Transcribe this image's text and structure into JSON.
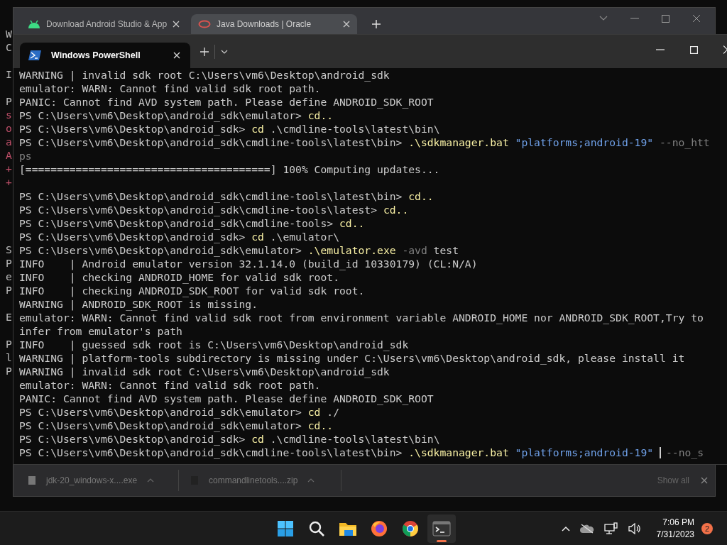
{
  "background_window": {
    "groups": [
      {
        "fragments": [
          {
            "text": "W",
            "color": "#bbbbbb"
          },
          {
            "text": "C",
            "color": "#bbbbbb"
          }
        ]
      },
      {
        "fragments": [
          {
            "text": "I",
            "color": "#bbbbbb"
          }
        ]
      },
      {
        "fragments": [
          {
            "text": "P",
            "color": "#bbbbbb"
          },
          {
            "text": "s",
            "color": "#c0506a"
          },
          {
            "text": "o",
            "color": "#c0506a"
          },
          {
            "text": "a",
            "color": "#c0506a"
          },
          {
            "text": "A",
            "color": "#c0506a"
          },
          {
            "text": "+",
            "color": "#c0506a"
          },
          {
            "text": "+",
            "color": "#c0506a"
          }
        ]
      },
      {
        "fragments": [
          {
            "text": "S",
            "color": "#bbbbbb"
          },
          {
            "text": "P",
            "color": "#bbbbbb"
          },
          {
            "text": "e",
            "color": "#bbbbbb"
          },
          {
            "text": "P",
            "color": "#bbbbbb"
          }
        ]
      },
      {
        "fragments": [
          {
            "text": "E",
            "color": "#bbbbbb"
          }
        ]
      },
      {
        "fragments": [
          {
            "text": "P",
            "color": "#bbbbbb"
          },
          {
            "text": "l",
            "color": "#bbbbbb"
          },
          {
            "text": "P",
            "color": "#bbbbbb"
          }
        ]
      }
    ]
  },
  "browser": {
    "tabs": [
      {
        "title": "Download Android Studio & App",
        "kind": "android",
        "selected": false
      },
      {
        "title": "Java Downloads | Oracle",
        "kind": "oracle",
        "selected": true
      }
    ],
    "downloads": [
      {
        "name": "jdk-20_windows-x....exe",
        "kind": "file"
      },
      {
        "name": "commandlinetools....zip",
        "kind": "zip"
      }
    ],
    "show_all": "Show all"
  },
  "terminal": {
    "tabs": [
      {
        "title": "Windows PowerShell",
        "selected": true
      }
    ],
    "lines": [
      {
        "kind": "text",
        "segments": [
          {
            "text": "WARNING | invalid sdk root C:\\Users\\vm6\\Desktop\\android_sdk",
            "kind": "output"
          }
        ]
      },
      {
        "kind": "text",
        "segments": [
          {
            "text": "emulator: WARN: Cannot find valid sdk root path.",
            "kind": "output"
          }
        ]
      },
      {
        "kind": "text",
        "segments": [
          {
            "text": "PANIC: Cannot find AVD system path. Please define ANDROID_SDK_ROOT",
            "kind": "output"
          }
        ]
      },
      {
        "kind": "text",
        "segments": [
          {
            "text": "PS C:\\Users\\vm6\\Desktop\\android_sdk\\emulator> ",
            "kind": "prompt"
          },
          {
            "text": "cd..",
            "kind": "command"
          }
        ]
      },
      {
        "kind": "text",
        "segments": [
          {
            "text": "PS C:\\Users\\vm6\\Desktop\\android_sdk> ",
            "kind": "prompt"
          },
          {
            "text": "cd",
            "kind": "command"
          },
          {
            "text": " .\\cmdline-tools\\latest\\bin\\",
            "kind": "argument"
          }
        ]
      },
      {
        "kind": "text",
        "segments": [
          {
            "text": "PS C:\\Users\\vm6\\Desktop\\android_sdk\\cmdline-tools\\latest\\bin> ",
            "kind": "prompt"
          },
          {
            "text": ".\\sdkmanager.bat",
            "kind": "command"
          },
          {
            "text": " \"platforms;android-19\"",
            "kind": "string"
          },
          {
            "text": " --no_htt",
            "kind": "parameter"
          }
        ]
      },
      {
        "kind": "text",
        "segments": [
          {
            "text": "ps",
            "kind": "parameter"
          }
        ]
      },
      {
        "kind": "text",
        "segments": [
          {
            "text": "[=======================================] 100% Computing updates...",
            "kind": "output"
          }
        ]
      },
      {
        "kind": "blank"
      },
      {
        "kind": "text",
        "segments": [
          {
            "text": "PS C:\\Users\\vm6\\Desktop\\android_sdk\\cmdline-tools\\latest\\bin> ",
            "kind": "prompt"
          },
          {
            "text": "cd..",
            "kind": "command"
          }
        ]
      },
      {
        "kind": "text",
        "segments": [
          {
            "text": "PS C:\\Users\\vm6\\Desktop\\android_sdk\\cmdline-tools\\latest> ",
            "kind": "prompt"
          },
          {
            "text": "cd..",
            "kind": "command"
          }
        ]
      },
      {
        "kind": "text",
        "segments": [
          {
            "text": "PS C:\\Users\\vm6\\Desktop\\android_sdk\\cmdline-tools> ",
            "kind": "prompt"
          },
          {
            "text": "cd..",
            "kind": "command"
          }
        ]
      },
      {
        "kind": "text",
        "segments": [
          {
            "text": "PS C:\\Users\\vm6\\Desktop\\android_sdk> ",
            "kind": "prompt"
          },
          {
            "text": "cd",
            "kind": "command"
          },
          {
            "text": " .\\emulator\\",
            "kind": "argument"
          }
        ]
      },
      {
        "kind": "text",
        "segments": [
          {
            "text": "PS C:\\Users\\vm6\\Desktop\\android_sdk\\emulator> ",
            "kind": "prompt"
          },
          {
            "text": ".\\emulator.exe",
            "kind": "command"
          },
          {
            "text": " -avd",
            "kind": "parameter"
          },
          {
            "text": " test",
            "kind": "argument"
          }
        ]
      },
      {
        "kind": "text",
        "segments": [
          {
            "text": "INFO    | Android emulator version 32.1.14.0 (build_id 10330179) (CL:N/A)",
            "kind": "output"
          }
        ]
      },
      {
        "kind": "text",
        "segments": [
          {
            "text": "INFO    | checking ANDROID_HOME for valid sdk root.",
            "kind": "output"
          }
        ]
      },
      {
        "kind": "text",
        "segments": [
          {
            "text": "INFO    | checking ANDROID_SDK_ROOT for valid sdk root.",
            "kind": "output"
          }
        ]
      },
      {
        "kind": "text",
        "segments": [
          {
            "text": "WARNING | ANDROID_SDK_ROOT is missing.",
            "kind": "output"
          }
        ]
      },
      {
        "kind": "text",
        "segments": [
          {
            "text": "emulator: WARN: Cannot find valid sdk root from environment variable ANDROID_HOME nor ANDROID_SDK_ROOT,Try to",
            "kind": "output"
          }
        ]
      },
      {
        "kind": "text",
        "segments": [
          {
            "text": "infer from emulator's path",
            "kind": "output"
          }
        ]
      },
      {
        "kind": "text",
        "segments": [
          {
            "text": "INFO    | guessed sdk root is C:\\Users\\vm6\\Desktop\\android_sdk",
            "kind": "output"
          }
        ]
      },
      {
        "kind": "text",
        "segments": [
          {
            "text": "WARNING | platform-tools subdirectory is missing under C:\\Users\\vm6\\Desktop\\android_sdk, please install it",
            "kind": "output"
          }
        ]
      },
      {
        "kind": "text",
        "segments": [
          {
            "text": "WARNING | invalid sdk root C:\\Users\\vm6\\Desktop\\android_sdk",
            "kind": "output"
          }
        ]
      },
      {
        "kind": "text",
        "segments": [
          {
            "text": "emulator: WARN: Cannot find valid sdk root path.",
            "kind": "output"
          }
        ]
      },
      {
        "kind": "text",
        "segments": [
          {
            "text": "PANIC: Cannot find AVD system path. Please define ANDROID_SDK_ROOT",
            "kind": "output"
          }
        ]
      },
      {
        "kind": "text",
        "segments": [
          {
            "text": "PS C:\\Users\\vm6\\Desktop\\android_sdk\\emulator> ",
            "kind": "prompt"
          },
          {
            "text": "cd",
            "kind": "command"
          },
          {
            "text": " ./",
            "kind": "argument"
          }
        ]
      },
      {
        "kind": "text",
        "segments": [
          {
            "text": "PS C:\\Users\\vm6\\Desktop\\android_sdk\\emulator> ",
            "kind": "prompt"
          },
          {
            "text": "cd..",
            "kind": "command"
          }
        ]
      },
      {
        "kind": "text",
        "segments": [
          {
            "text": "PS C:\\Users\\vm6\\Desktop\\android_sdk> ",
            "kind": "prompt"
          },
          {
            "text": "cd",
            "kind": "command"
          },
          {
            "text": " .\\cmdline-tools\\latest\\bin\\",
            "kind": "argument"
          }
        ]
      },
      {
        "kind": "text",
        "segments": [
          {
            "text": "PS C:\\Users\\vm6\\Desktop\\android_sdk\\cmdline-tools\\latest\\bin> ",
            "kind": "prompt"
          },
          {
            "text": ".\\sdkmanager.bat",
            "kind": "command"
          },
          {
            "text": " \"platforms;android-19\" ",
            "kind": "string"
          },
          {
            "kind": "cursor"
          },
          {
            "text": "--no_s",
            "kind": "parameter"
          }
        ]
      }
    ]
  },
  "taskbar": {
    "apps": [
      {
        "kind": "start",
        "active": false
      },
      {
        "kind": "search",
        "active": false
      },
      {
        "kind": "folder",
        "active": false
      },
      {
        "kind": "firefox",
        "active": false
      },
      {
        "kind": "chrome",
        "active": false
      },
      {
        "kind": "terminal",
        "active": true
      }
    ],
    "time": "7:06 PM",
    "date": "7/31/2023",
    "notifications": "2"
  }
}
